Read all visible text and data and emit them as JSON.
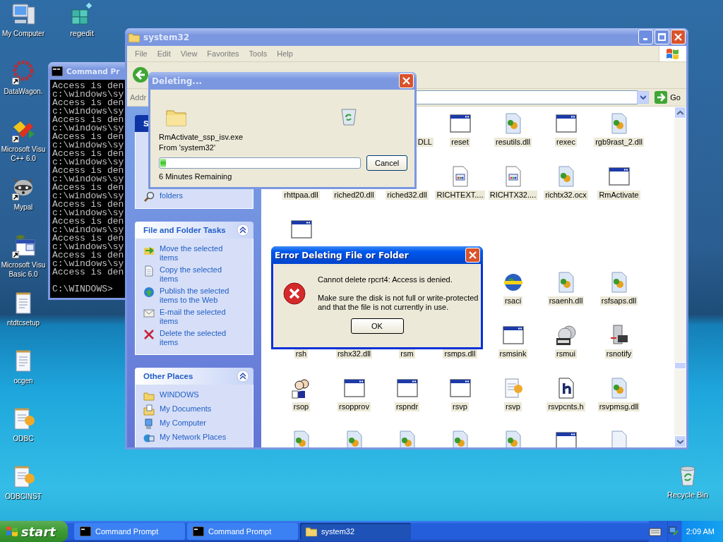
{
  "desktop": {
    "columns": [
      [
        {
          "lines": [
            "My Computer"
          ],
          "kind": "computer",
          "shortcut": false
        },
        {
          "lines": [
            "DataWagon."
          ],
          "kind": "flower",
          "shortcut": true
        },
        {
          "lines": [
            "Microsoft Visu",
            "C++ 6.0"
          ],
          "kind": "shapes",
          "shortcut": true
        },
        {
          "lines": [
            "Mypal"
          ],
          "kind": "raccoon",
          "shortcut": true
        },
        {
          "lines": [
            "Microsoft Visu",
            "Basic 6.0"
          ],
          "kind": "vb",
          "shortcut": true
        },
        {
          "lines": [
            "ntdtcsetup"
          ],
          "kind": "notepad",
          "shortcut": false
        },
        {
          "lines": [
            "ocgen"
          ],
          "kind": "notepad",
          "shortcut": false
        },
        {
          "lines": [
            "ODBC"
          ],
          "kind": "notepadgear",
          "shortcut": false
        },
        {
          "lines": [
            "ODBCINST"
          ],
          "kind": "notepadgear",
          "shortcut": false
        }
      ],
      [
        {
          "lines": [
            "regedit"
          ],
          "kind": "cubes",
          "shortcut": false
        }
      ]
    ],
    "recycle_bin": {
      "label": "Recycle Bin"
    }
  },
  "command_prompt": {
    "title": "Command Pr",
    "active": false,
    "lines": [
      "Access is den",
      "c:\\windows\\sy",
      "Access is den",
      "c:\\windows\\sy",
      "Access is den",
      "c:\\windows\\sy",
      "Access is den",
      "c:\\windows\\sy",
      "Access is den",
      "c:\\windows\\sy",
      "Access is den",
      "c:\\windows\\sy",
      "Access is den",
      "c:\\windows\\sy",
      "Access is den",
      "c:\\windows\\sy",
      "Access is den",
      "c:\\windows\\sy",
      "Access is den",
      "c:\\windows\\sy",
      "Access is den",
      "c:\\windows\\sy",
      "Access is den"
    ],
    "prompt": "C:\\WINDOWS>"
  },
  "explorer": {
    "title": "system32",
    "active": false,
    "menu": [
      "File",
      "Edit",
      "View",
      "Favorites",
      "Tools",
      "Help"
    ],
    "address_label": "Addr",
    "go": "Go",
    "task_panes": [
      {
        "title": "S",
        "special": true,
        "items": [
          {
            "label": "folders",
            "kind": "search"
          }
        ]
      },
      {
        "title": "File and Folder Tasks",
        "special": false,
        "items": [
          {
            "label": "Move the selected items",
            "kind": "move"
          },
          {
            "label": "Copy the selected items",
            "kind": "copy"
          },
          {
            "label": "Publish the selected items to the Web",
            "kind": "publish"
          },
          {
            "label": "E-mail the selected items",
            "kind": "email"
          },
          {
            "label": "Delete the selected items",
            "kind": "delete"
          }
        ]
      },
      {
        "title": "Other Places",
        "special": false,
        "items": [
          {
            "label": "WINDOWS",
            "kind": "folder"
          },
          {
            "label": "My Documents",
            "kind": "documents"
          },
          {
            "label": "My Computer",
            "kind": "computer"
          },
          {
            "label": "My Network Places",
            "kind": "network"
          }
        ]
      }
    ],
    "files": [
      [
        {
          "kind": "empty"
        },
        {
          "kind": "empty"
        },
        {
          "name": "DLL",
          "kind": "cut",
          "selected": true
        },
        {
          "name": "reset",
          "kind": "app",
          "selected": true
        },
        {
          "name": "resutils.dll",
          "kind": "dll",
          "selected": true
        },
        {
          "name": "rexec",
          "kind": "app",
          "selected": true
        },
        {
          "name": "rgb9rast_2.dll",
          "kind": "dll",
          "selected": true
        }
      ],
      [
        {
          "name": "rhttpaa.dll",
          "kind": "label",
          "selected": true
        },
        {
          "name": "riched20.dll",
          "kind": "label",
          "selected": true
        },
        {
          "name": "riched32.dll",
          "kind": "label",
          "selected": true
        },
        {
          "name": "RICHTEXT....",
          "kind": "richtext",
          "selected": true
        },
        {
          "name": "RICHTX32....",
          "kind": "richtext",
          "selected": true
        },
        {
          "name": "richtx32.ocx",
          "kind": "dll",
          "selected": true
        },
        {
          "name": "RmActivate",
          "kind": "app",
          "selected": true
        }
      ],
      [
        {
          "kind": "app"
        },
        {
          "kind": "empty"
        },
        {
          "kind": "empty"
        },
        {
          "kind": "empty"
        },
        {
          "kind": "empty"
        },
        {
          "kind": "empty"
        },
        {
          "kind": "empty"
        }
      ],
      [
        {
          "kind": "empty"
        },
        {
          "kind": "empty"
        },
        {
          "kind": "empty"
        },
        {
          "kind": "empty"
        },
        {
          "name": "rsaci",
          "kind": "globe",
          "selected": true
        },
        {
          "name": "rsaenh.dll",
          "kind": "dll",
          "selected": true
        },
        {
          "name": "rsfsaps.dll",
          "kind": "dll",
          "selected": true
        }
      ],
      [
        {
          "name": "rsh",
          "kind": "label",
          "selected": true
        },
        {
          "name": "rshx32.dll",
          "kind": "label",
          "selected": true
        },
        {
          "name": "rsm",
          "kind": "label",
          "selected": true
        },
        {
          "name": "rsmps.dll",
          "kind": "label",
          "selected": true
        },
        {
          "name": "rsmsink",
          "kind": "app",
          "selected": true
        },
        {
          "name": "rsmui",
          "kind": "cd",
          "selected": true
        },
        {
          "name": "rsnotify",
          "kind": "server",
          "selected": true
        }
      ],
      [
        {
          "name": "rsop",
          "kind": "people",
          "selected": true
        },
        {
          "name": "rsopprov",
          "kind": "app",
          "selected": true
        },
        {
          "name": "rspndr",
          "kind": "app",
          "selected": true
        },
        {
          "name": "rsvp",
          "kind": "app",
          "selected": true
        },
        {
          "name": "rsvp",
          "kind": "notepad",
          "selected": true
        },
        {
          "name": "rsvpcnts.h",
          "kind": "h",
          "selected": true
        },
        {
          "name": "rsvpmsg.dll",
          "kind": "dll",
          "selected": true
        }
      ],
      [
        {
          "kind": "dll"
        },
        {
          "kind": "dll"
        },
        {
          "kind": "dll"
        },
        {
          "kind": "dll"
        },
        {
          "kind": "dll"
        },
        {
          "kind": "app"
        },
        {
          "kind": "blank"
        }
      ]
    ]
  },
  "deleting_dialog": {
    "title": "Deleting...",
    "active": false,
    "file": "RmActivate_ssp_isv.exe",
    "from": "From 'system32'",
    "level": 0.03,
    "remaining": "6 Minutes Remaining",
    "cancel": "Cancel"
  },
  "error_dialog": {
    "title": "Error Deleting File or Folder",
    "active": true,
    "message": "Cannot delete rpcrt4: Access is denied.",
    "detail": "Make sure the disk is not full or write-protected and that the file is not currently in use.",
    "ok": "OK"
  },
  "taskbar": {
    "start": "start",
    "tasks": [
      {
        "label": "Command Prompt",
        "kind": "cmd",
        "selected": false
      },
      {
        "label": "Command Prompt",
        "kind": "cmd",
        "selected": false
      },
      {
        "label": "system32",
        "kind": "folder",
        "selected": true
      }
    ],
    "clock": "2:09 AM"
  }
}
